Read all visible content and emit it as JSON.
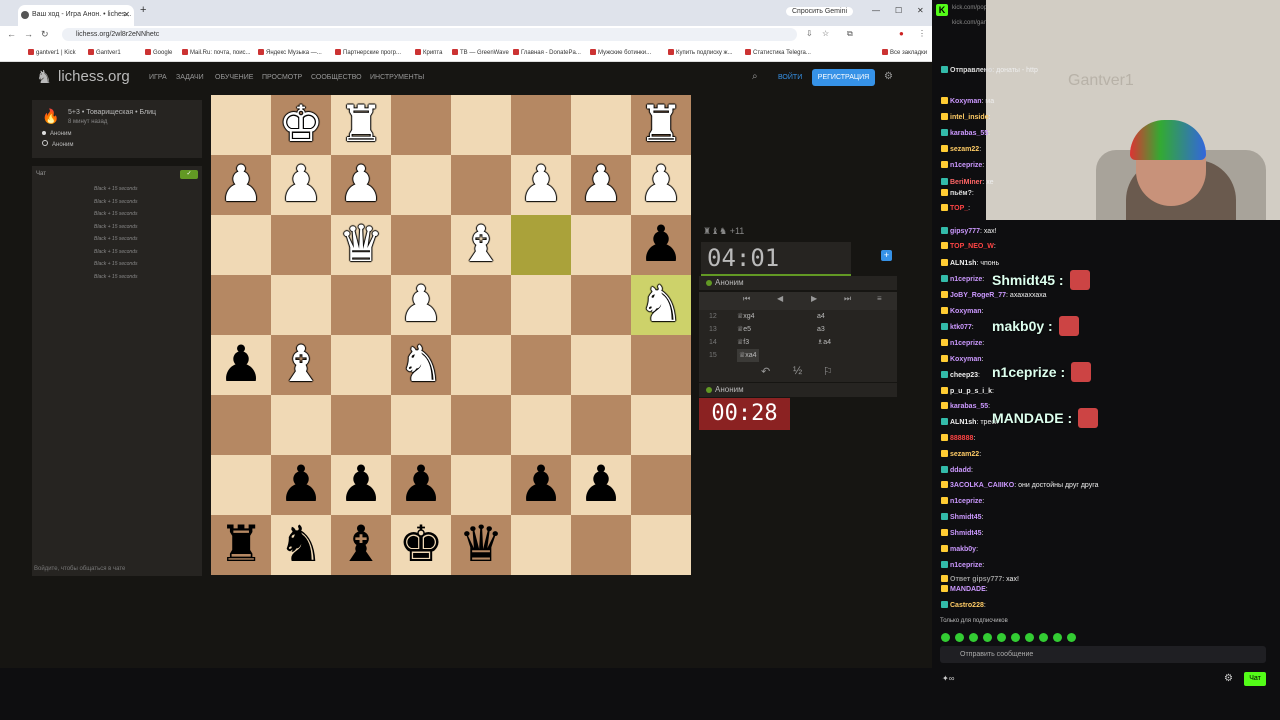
{
  "browser": {
    "tab_title": "Ваш ход - Игра Анон. • liches...",
    "new_tab": "+",
    "url": "lichess.org/2wl8r2eNNhetc",
    "gemini_label": "Спросить Gemini",
    "bookmarks": [
      "gantver1 | Kick",
      "Gantver1",
      "Google",
      "Mail.Ru: почта, поис...",
      "Яндекс Музыка —...",
      "Партнерские прогр...",
      "Крипта",
      "TB — GreenWave",
      "Главная - DonatePa...",
      "Мужские ботинки...",
      "Купить подписку ж...",
      "Статистика Telegra...",
      "Все закладки"
    ]
  },
  "lichess": {
    "logo": "lichess.org",
    "nav": [
      "Игра",
      "Задачи",
      "Обучение",
      "Просмотр",
      "Сообщество",
      "Инструменты"
    ],
    "login": "ВОЙТИ",
    "signup": "РЕГИСТРАЦИЯ",
    "game_type": "5+3 • Товарищеская • Блиц",
    "game_time": "8 минут назад",
    "player_white": "Аноним",
    "player_black": "Аноним",
    "chat_title": "Чат",
    "chat_lines": [
      "Black + 15 seconds",
      "Black + 15 seconds",
      "Black + 15 seconds",
      "Black + 15 seconds",
      "Black + 15 seconds",
      "Black + 15 seconds",
      "Black + 15 seconds",
      "Black + 15 seconds"
    ],
    "chat_footer": "Войдите, чтобы общаться в чате",
    "material": "♜♝♞ +11",
    "clock_top": "04:01",
    "clock_bottom": "00:28",
    "top_player": "Аноним",
    "bottom_player": "Аноним",
    "moves": [
      {
        "n": "12",
        "w": "♕xg4",
        "b": "a4"
      },
      {
        "n": "13",
        "w": "♕e5",
        "b": "a3"
      },
      {
        "n": "14",
        "w": "♕f3",
        "b": "♗a4"
      },
      {
        "n": "15",
        "w": "♕xa4",
        "b": ""
      }
    ],
    "draw_label": "½",
    "board": [
      [
        "",
        "wK",
        "wR",
        "",
        "",
        "",
        "",
        "wR"
      ],
      [
        "wP",
        "wP",
        "wP",
        "",
        "",
        "wP",
        "wP",
        "wP"
      ],
      [
        "",
        "",
        "wQ",
        "",
        "wB",
        "",
        "",
        "bP"
      ],
      [
        "",
        "",
        "",
        "wP",
        "",
        "",
        "",
        "wN"
      ],
      [
        "bP",
        "wB",
        "",
        "wN",
        "",
        "",
        "",
        ""
      ],
      [
        "",
        "",
        "",
        "",
        "",
        "",
        "",
        ""
      ],
      [
        "",
        "bP",
        "bP",
        "bP",
        "",
        "bP",
        "bP",
        ""
      ],
      [
        "bR",
        "bN",
        "bB",
        "bK",
        "bQ",
        "",
        "",
        ""
      ]
    ],
    "highlights": [
      [
        2,
        5
      ],
      [
        3,
        7
      ]
    ]
  },
  "stream": {
    "kick_url": "kick.com/popout/gantver1...",
    "kick_url2": "kick.com/gan...",
    "webcam_sign": "Gantver1",
    "messages": [
      {
        "user": "Отправлено",
        "text": "донаты - http",
        "color": "#ddd"
      },
      {
        "user": "Koxyman",
        "text": "ма",
        "color": "#c9f"
      },
      {
        "user": "intel_inside",
        "text": "",
        "color": "#fc6"
      },
      {
        "user": "karabas_55",
        "text": "",
        "color": "#c9f"
      },
      {
        "user": "sezam22",
        "text": "",
        "color": "#fc6"
      },
      {
        "user": "n1ceprize",
        "text": "",
        "color": "#c9f"
      },
      {
        "user": "BeriMiner",
        "text": "хе",
        "color": "#f66"
      },
      {
        "user": "пьём?",
        "text": "",
        "color": "#ddd"
      },
      {
        "user": "TOP_",
        "text": "",
        "color": "#f44"
      },
      {
        "user": "gipsy777",
        "text": "хах!",
        "color": "#c9f"
      },
      {
        "user": "TOP_NEO_W",
        "text": "",
        "color": "#f44"
      },
      {
        "user": "ALN1sh",
        "text": "чпонь",
        "color": "#eee"
      },
      {
        "user": "n1ceprize",
        "text": "",
        "color": "#c9f"
      },
      {
        "user": "JoBY_RogeR_77",
        "text": "ахахаххаха",
        "color": "#c9f"
      },
      {
        "user": "Koxyman",
        "text": "",
        "color": "#c9f"
      },
      {
        "user": "ktk077",
        "text": "",
        "color": "#c9f"
      },
      {
        "user": "n1ceprize",
        "text": "",
        "color": "#c9f"
      },
      {
        "user": "Koxyman",
        "text": "",
        "color": "#c9f"
      },
      {
        "user": "cheep23",
        "text": "",
        "color": "#eee"
      },
      {
        "user": "p_u_p_s_i_k",
        "text": "",
        "color": "#eee"
      },
      {
        "user": "karabas_55",
        "text": "",
        "color": "#c9f"
      },
      {
        "user": "ALN1sh",
        "text": "треск",
        "color": "#eee"
      },
      {
        "user": "888888",
        "text": "",
        "color": "#f44"
      },
      {
        "user": "sezam22",
        "text": "",
        "color": "#fc6"
      },
      {
        "user": "ddadd",
        "text": "",
        "color": "#c9f"
      },
      {
        "user": "3ACOLKA_CAIIIKO",
        "text": "они достойны друг друга",
        "color": "#c9f"
      },
      {
        "user": "n1ceprize",
        "text": "",
        "color": "#c9f"
      },
      {
        "user": "Shmidt45",
        "text": "",
        "color": "#c9f"
      },
      {
        "user": "Shmidt45",
        "text": "",
        "color": "#c9f"
      },
      {
        "user": "makb0y",
        "text": "",
        "color": "#c9f"
      },
      {
        "user": "n1ceprize",
        "text": "",
        "color": "#c9f"
      },
      {
        "user": "Ответ gipsy777",
        "text": "хах!",
        "color": "#999"
      },
      {
        "user": "MANDADE",
        "text": "",
        "color": "#c9f"
      },
      {
        "user": "Castro228",
        "text": "",
        "color": "#fc6"
      }
    ],
    "big_names": [
      "Shmidt45 :",
      "makb0y :",
      "n1ceprize :",
      "MANDADE :"
    ],
    "subs_only": "Только для подписчиков",
    "input_placeholder": "Отправить сообщение",
    "chat_button": "Чат"
  }
}
